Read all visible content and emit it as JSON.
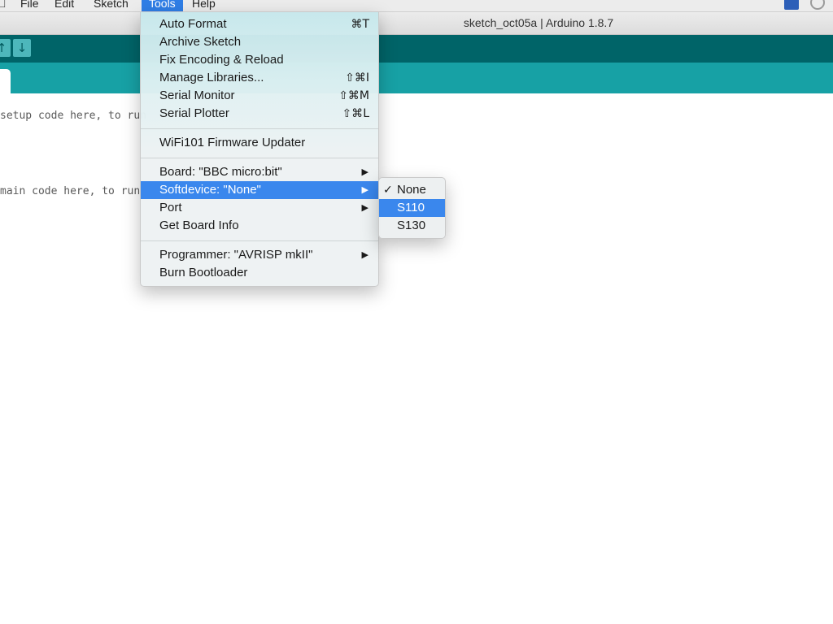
{
  "menubar": {
    "items": [
      {
        "label": "File"
      },
      {
        "label": "Edit"
      },
      {
        "label": "Sketch"
      },
      {
        "label": "Tools"
      },
      {
        "label": "Help"
      }
    ],
    "active": "Tools"
  },
  "window": {
    "title": "sketch_oct05a | Arduino 1.8.7"
  },
  "toolbar": {
    "buttons": [
      {
        "icon": "open-icon",
        "glyph": "↑"
      },
      {
        "icon": "save-icon",
        "glyph": "↓"
      }
    ]
  },
  "editor": {
    "lines": [
      "setup code here, to run",
      "main code here, to run"
    ]
  },
  "tools_menu": {
    "auto_format": {
      "label": "Auto Format",
      "shortcut": "⌘T"
    },
    "archive_sketch": {
      "label": "Archive Sketch"
    },
    "fix_encoding": {
      "label": "Fix Encoding & Reload"
    },
    "manage_libraries": {
      "label": "Manage Libraries...",
      "shortcut": "⇧⌘I"
    },
    "serial_monitor": {
      "label": "Serial Monitor",
      "shortcut": "⇧⌘M"
    },
    "serial_plotter": {
      "label": "Serial Plotter",
      "shortcut": "⇧⌘L"
    },
    "wifi_updater": {
      "label": "WiFi101 Firmware Updater"
    },
    "board": {
      "label": "Board: \"BBC micro:bit\""
    },
    "softdevice": {
      "label": "Softdevice: \"None\""
    },
    "port": {
      "label": "Port"
    },
    "board_info": {
      "label": "Get Board Info"
    },
    "programmer": {
      "label": "Programmer: \"AVRISP mkII\""
    },
    "burn_bootloader": {
      "label": "Burn Bootloader"
    },
    "submenu_arrow": "▶"
  },
  "softdevice_menu": {
    "check": "✓",
    "items": [
      {
        "label": "None",
        "checked": true
      },
      {
        "label": "S110",
        "highlighted": true
      },
      {
        "label": "S130"
      }
    ]
  },
  "colors": {
    "toolbar": "#006468",
    "tabbar": "#17a1a5",
    "menu_highlight": "#3a87ed"
  }
}
